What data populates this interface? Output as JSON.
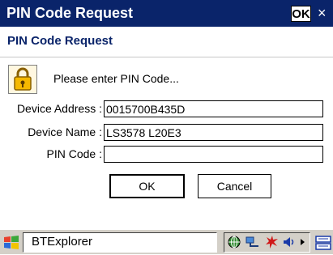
{
  "window": {
    "title": "PIN Code Request",
    "ok_label": "OK",
    "close_glyph": "×"
  },
  "dialog": {
    "heading": "PIN Code Request",
    "icon": "padlock-icon",
    "prompt": "Please enter PIN Code...",
    "fields": {
      "device_address_label": "Device Address :",
      "device_address_value": "0015700B435D",
      "device_name_label": "Device Name :",
      "device_name_value": "LS3578 L20E3",
      "pin_code_label": "PIN Code :",
      "pin_code_value": ""
    },
    "ok_button": "OK",
    "cancel_button": "Cancel"
  },
  "taskbar": {
    "start_icon": "windows-flag-icon",
    "active_app": "BTExplorer",
    "tray_icons": [
      "network-globe-icon",
      "connectivity-icon",
      "bluetooth-icon",
      "volume-icon",
      "chevron-right-icon"
    ],
    "input_icon": "keyboard-icon"
  },
  "colors": {
    "titlebar": "#0a246a",
    "subtitle_text": "#0a246a",
    "taskbar": "#d4d0c8"
  }
}
